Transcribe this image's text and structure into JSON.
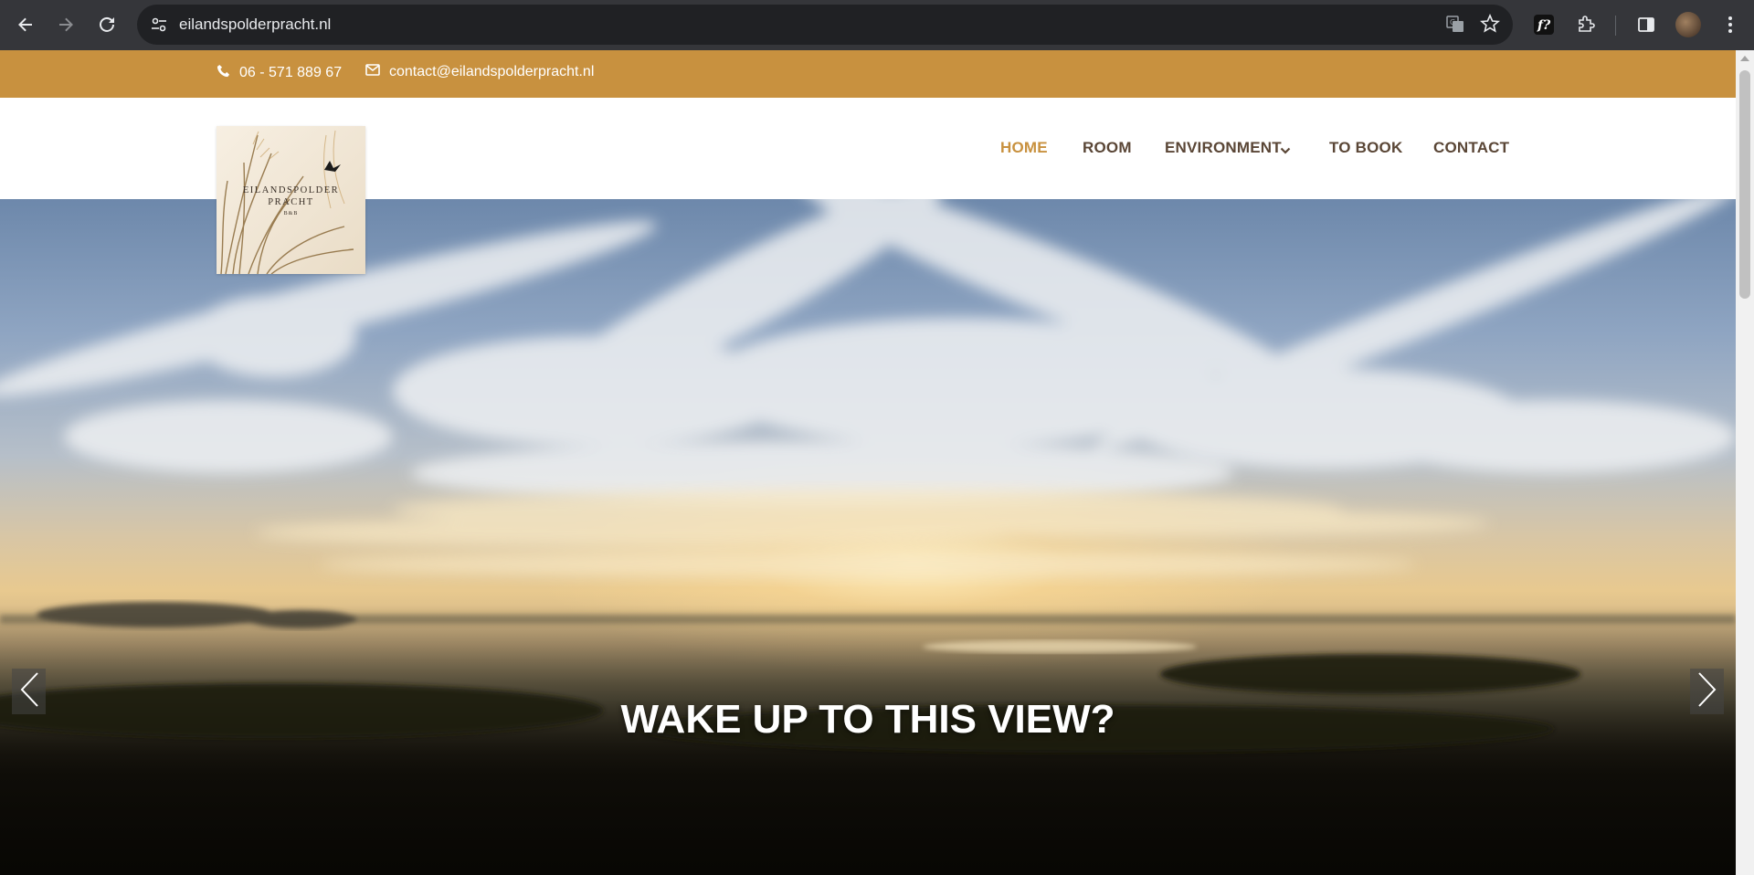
{
  "browser": {
    "url": "eilandspolderpracht.nl",
    "icons": {
      "back": "back-arrow-icon",
      "forward": "forward-arrow-icon",
      "reload": "reload-icon",
      "site_info": "site-info-icon",
      "translate": "translate-icon",
      "bookmark": "star-icon",
      "font_ext": "font-extension-icon",
      "extensions": "puzzle-icon",
      "side_panel": "side-panel-icon",
      "menu": "kebab-menu-icon"
    }
  },
  "topbar": {
    "phone": "06 - 571 889 67",
    "email": "contact@eilandspolderpracht.nl",
    "bg_color": "#c8913f"
  },
  "logo": {
    "name_line1": "EILANDSPOLDER",
    "name_line2": "PRACHT",
    "sub": "B&B"
  },
  "menu": {
    "items": [
      {
        "label": "HOME",
        "active": true
      },
      {
        "label": "ROOM",
        "active": false
      },
      {
        "label": "ENVIRONMENT",
        "active": false,
        "has_dropdown": true
      },
      {
        "label": "TO BOOK",
        "active": false
      },
      {
        "label": "CONTACT",
        "active": false
      }
    ],
    "active_color": "#c8913f",
    "text_color": "#5a4636"
  },
  "hero": {
    "title": "WAKE UP TO THIS VIEW?"
  }
}
